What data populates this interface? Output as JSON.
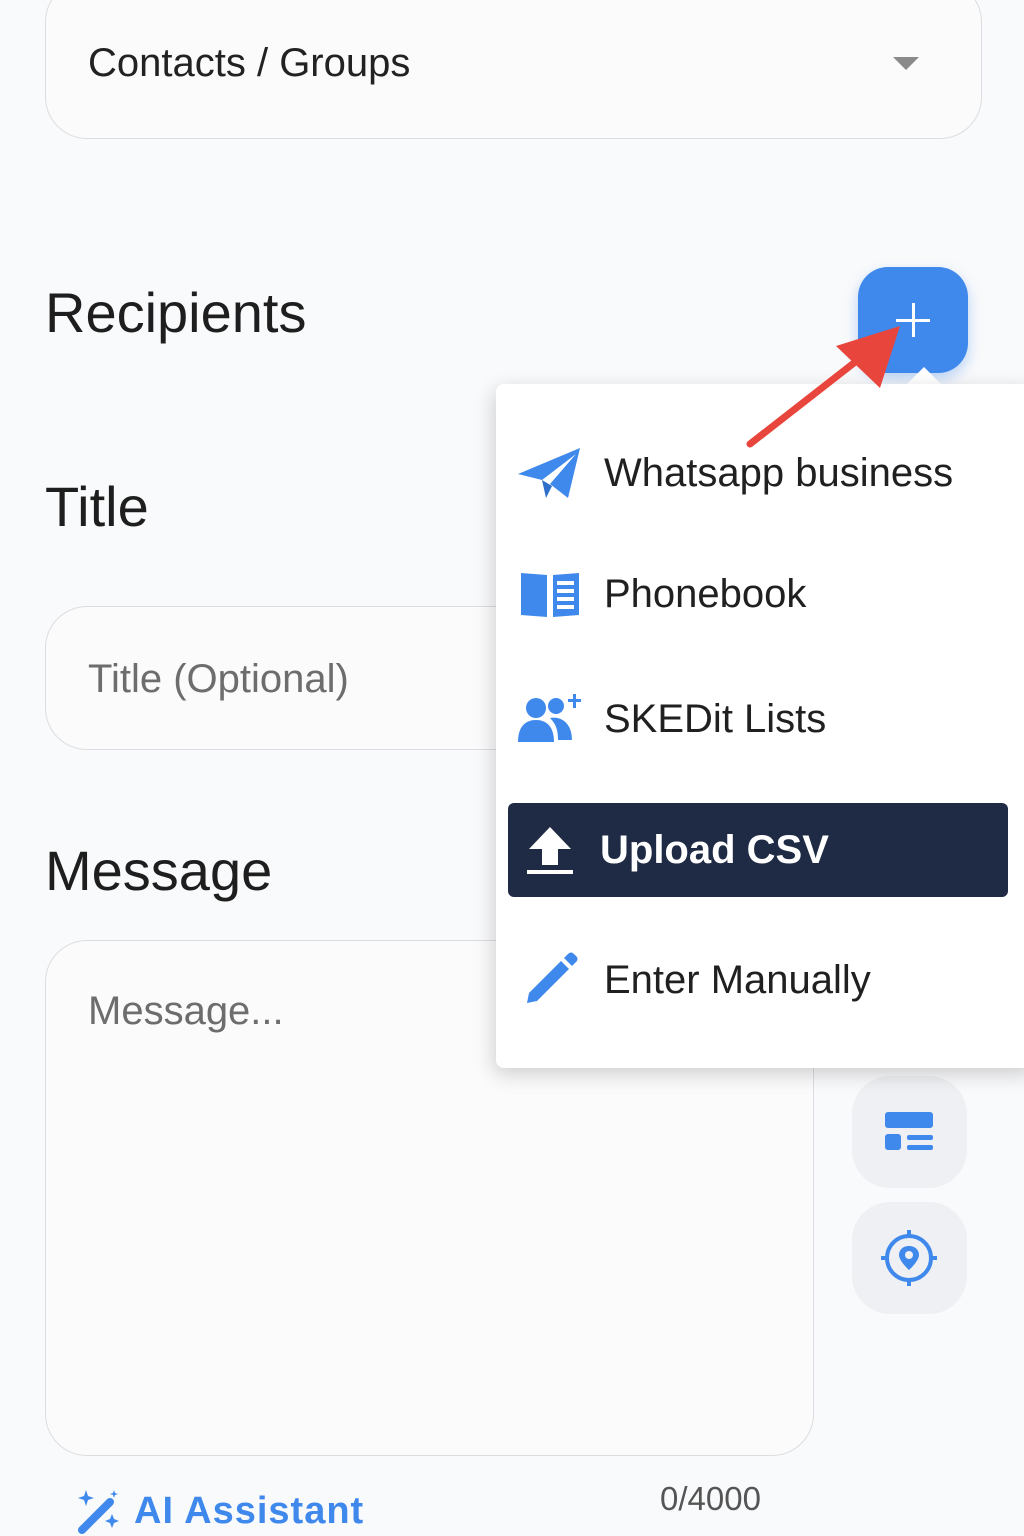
{
  "contacts_select": {
    "value": "Contacts / Groups"
  },
  "recipients": {
    "label": "Recipients",
    "add_button_icon": "plus-icon"
  },
  "title": {
    "label": "Title",
    "placeholder": "Title (Optional)"
  },
  "message": {
    "label": "Message",
    "placeholder": "Message...",
    "char_count": "0/4000"
  },
  "ai_assistant": {
    "label": "AI Assistant",
    "icon": "magic-wand-icon"
  },
  "side_tools": [
    {
      "icon": "template-icon"
    },
    {
      "icon": "location-icon"
    }
  ],
  "recipients_menu": {
    "items": [
      {
        "label": "Whatsapp business",
        "icon": "send-icon"
      },
      {
        "label": "Phonebook",
        "icon": "book-icon"
      },
      {
        "label": "SKEDit Lists",
        "icon": "users-add-icon"
      },
      {
        "label": "Upload CSV",
        "icon": "upload-icon",
        "selected": true
      },
      {
        "label": "Enter Manually",
        "icon": "pencil-icon"
      }
    ]
  },
  "colors": {
    "accent": "#3f88ec",
    "selected_bg": "#1f2a44",
    "arrow": "#e8463c"
  }
}
